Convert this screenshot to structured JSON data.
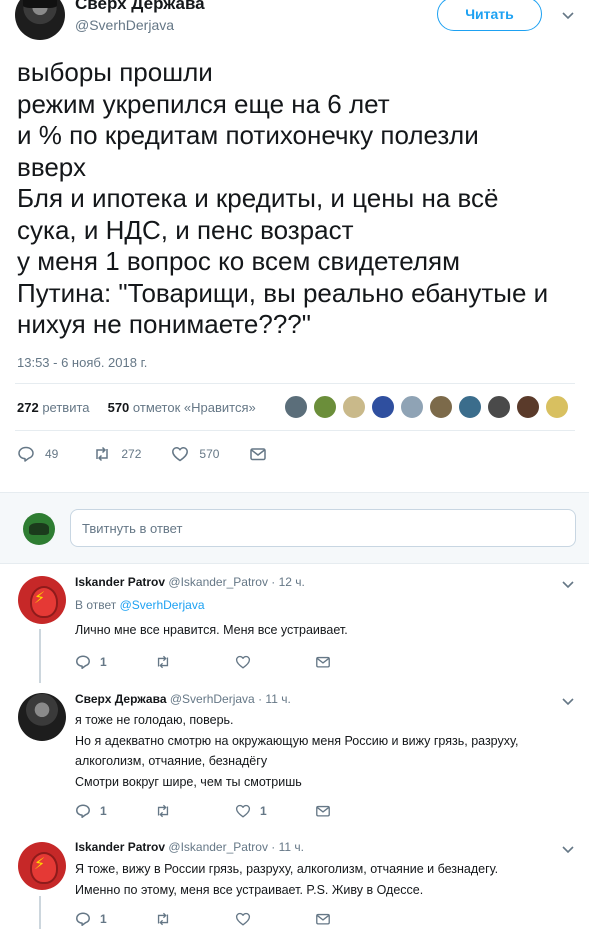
{
  "tweet": {
    "author_name": "Сверх Держава",
    "author_handle": "@SverhDerjava",
    "follow_label": "Читать",
    "text_lines": [
      "выборы прошли",
      "режим укрепился еще на 6 лет",
      "и % по кредитам потихонечку полезли",
      "вверх",
      "Бля и ипотека и кредиты, и цены на всё",
      "сука, и НДС, и пенс возраст",
      "у меня 1 вопрос ко всем свидетелям",
      "Путина: \"Товарищи, вы реально ебанутые и",
      "нихуя не понимаете???\""
    ],
    "timestamp": "13:53 - 6 нояб. 2018 г.",
    "retweet_count": "272",
    "retweet_label": "ретвита",
    "like_count": "570",
    "like_label": "отметок «Нравится»",
    "liker_colors": [
      "#5b6e7a",
      "#6b8e3a",
      "#c9b98a",
      "#2f4f9f",
      "#8fa3b5",
      "#7c6a4a",
      "#3b6d8c",
      "#4a4a4a",
      "#5a3a2a",
      "#d8c060"
    ],
    "actions": {
      "replies": "49",
      "retweets": "272",
      "likes": "570"
    }
  },
  "reply_box": {
    "placeholder": "Твитнуть в ответ"
  },
  "replies": [
    {
      "name": "Iskander Patrov",
      "handle": "@Iskander_Patrov",
      "time": "· 12 ч.",
      "reply_to_prefix": "В ответ",
      "reply_to_handle": "@SverhDerjava",
      "lines": [
        "Лично мне все нравится. Меня все устраивает."
      ],
      "reply_count": "1",
      "retweet_count": "",
      "like_count": ""
    },
    {
      "name": "Сверх Держава",
      "handle": "@SverhDerjava",
      "time": "· 11 ч.",
      "lines": [
        "я тоже не голодаю, поверь.",
        "Но я адекватно смотрю на окружающую меня Россию и вижу грязь, разруху,",
        "алкоголизм, отчаяние, безнадёгу",
        "Смотри вокруг шире, чем ты смотришь"
      ],
      "reply_count": "1",
      "retweet_count": "",
      "like_count": "1"
    },
    {
      "name": "Iskander Patrov",
      "handle": "@Iskander_Patrov",
      "time": "· 11 ч.",
      "lines": [
        "Я тоже, вижу в России грязь, разруху, алкоголизм, отчаяние и безнадегу.",
        "Именно по этому, меня все устраивает.  P.S.  Живу в Одессе."
      ],
      "reply_count": "1",
      "retweet_count": "",
      "like_count": ""
    }
  ],
  "colors": {
    "accent": "#1da1f2",
    "muted": "#657786",
    "text": "#14171a",
    "divider": "#e6ecf0"
  }
}
